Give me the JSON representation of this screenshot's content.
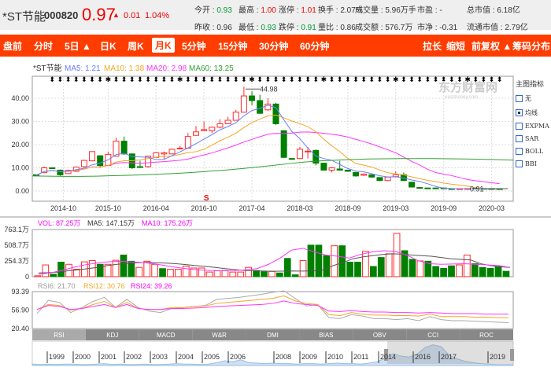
{
  "header": {
    "name": "*ST节能",
    "code": "000820",
    "price": "0.97",
    "change": "0.01",
    "change_pct": "1.04%",
    "quotes_row1": [
      [
        "今开",
        "0.93",
        "g"
      ],
      [
        "最高",
        "1.00",
        "r"
      ],
      [
        "涨停",
        "1.01",
        "r"
      ],
      [
        "换手",
        "2.07%",
        ""
      ],
      [
        "成交量",
        "5.96万手",
        ""
      ],
      [
        "市盈",
        "-",
        ""
      ],
      [
        "总市值",
        "6.18亿",
        ""
      ]
    ],
    "quotes_row2": [
      [
        "昨收",
        "0.96",
        ""
      ],
      [
        "最低",
        "0.93",
        "g"
      ],
      [
        "跌停",
        "0.91",
        "g"
      ],
      [
        "量比",
        "0.86",
        ""
      ],
      [
        "成交额",
        "576.7万",
        ""
      ],
      [
        "市净",
        "-0.31",
        ""
      ],
      [
        "流通市值",
        "2.79亿",
        ""
      ]
    ]
  },
  "nav": {
    "left": [
      "盘前",
      "分时",
      "5日 ▲",
      "日K",
      "周K",
      "月K",
      "5分钟",
      "15分钟",
      "30分钟",
      "60分钟"
    ],
    "active": "月K",
    "right": [
      "拉长",
      "缩短",
      "前复权 ▲",
      "筹码分布"
    ]
  },
  "main": {
    "title": "*ST节能",
    "ma5": "MA5: 1.21",
    "ma10": "MA10: 1.38",
    "ma20": "MA20: 2.98",
    "ma60": "MA60: 13.25",
    "yticks": [
      "40.00",
      "30.00",
      "20.00",
      "10.00",
      "0.00"
    ],
    "xticks": [
      "2014-10",
      "2015-10",
      "2016-04",
      "2016-10",
      "2017-04",
      "2018-03",
      "2018-09",
      "2019-03",
      "2019-09",
      "2020-03"
    ],
    "max_label": "44.98",
    "min_label": "0.91",
    "watermark": "东方财富网",
    "watermark_sub": "eastmoney.com",
    "marker": "S"
  },
  "side": {
    "title": "主图指标",
    "options": [
      {
        "label": "无",
        "checked": false
      },
      {
        "label": "均线",
        "checked": true
      },
      {
        "label": "EXPMA",
        "checked": false
      },
      {
        "label": "SAR",
        "checked": false
      },
      {
        "label": "BOLL",
        "checked": false
      },
      {
        "label": "BBI",
        "checked": false
      }
    ]
  },
  "volume": {
    "vol": "VOL: 87.25万",
    "ma5": "MA5: 147.15万",
    "ma10": "MA10: 175.26万",
    "yticks": [
      "763.1万",
      "508.7万",
      "254.3万",
      "0"
    ]
  },
  "rsi": {
    "rsi6": "RSI6: 21.70",
    "rsi12": "RSI12: 30.76",
    "rsi24": "RSI24: 39.26",
    "yticks": [
      "93.39",
      "56.90",
      "20.40"
    ]
  },
  "tabs": [
    "RSI",
    "KDJ",
    "MACD",
    "W&R",
    "DMI",
    "BIAS",
    "OBV",
    "CCI",
    "ROC"
  ],
  "active_tab": "RSI",
  "navigator": {
    "years": [
      "1999",
      "2000",
      "2001",
      "2002",
      "2003",
      "2004",
      "2005",
      "2006",
      "2008",
      "2009",
      "2010",
      "2011",
      "2014",
      "2016",
      "2017",
      "2019"
    ]
  },
  "colors": {
    "up": "#ff2a2a",
    "down": "#008000",
    "ma5": "#6b7fff",
    "ma10": "#f5a623",
    "ma20": "#ff33ff",
    "ma60": "#33a033",
    "accent": "#ff3d00"
  },
  "chart_data": {
    "type": "candlestick",
    "ylim": [
      -3,
      48
    ],
    "candles": [
      [
        7,
        6.8,
        7.2,
        6.6
      ],
      [
        7.9,
        10,
        10.5,
        7.8
      ],
      [
        10,
        9.8,
        10.2,
        9.5
      ],
      [
        9,
        7,
        9.3,
        6.5
      ],
      [
        7.5,
        8.9,
        9.2,
        7.3
      ],
      [
        8.5,
        10.3,
        10.6,
        8.4
      ],
      [
        10.5,
        13.2,
        13.5,
        10.2
      ],
      [
        13,
        17,
        17.2,
        12.8
      ],
      [
        15.2,
        11,
        15.4,
        10
      ],
      [
        11,
        15.8,
        17,
        10.8
      ],
      [
        15,
        21.5,
        23,
        14.8
      ],
      [
        21.5,
        16,
        23.5,
        15.5
      ],
      [
        16,
        10,
        16.2,
        9.5
      ],
      [
        10.5,
        10.2,
        13,
        10
      ],
      [
        10.5,
        15,
        15.2,
        10
      ],
      [
        14.5,
        16.5,
        16.8,
        14.3
      ],
      [
        16,
        16.5,
        17,
        13.5
      ],
      [
        16,
        18,
        18.3,
        15.8
      ],
      [
        18.2,
        18.5,
        19.5,
        18
      ],
      [
        18.5,
        23.5,
        25,
        18.3
      ],
      [
        24,
        25.5,
        28,
        23.8
      ],
      [
        26,
        26.5,
        30,
        25.8
      ],
      [
        26,
        27.5,
        27.8,
        25
      ],
      [
        27.5,
        29,
        31,
        27
      ],
      [
        29,
        30.5,
        32,
        28.8
      ],
      [
        30.5,
        34,
        35,
        30.3
      ],
      [
        34,
        41,
        44.98,
        33.8
      ],
      [
        41,
        39,
        43,
        37
      ],
      [
        39,
        33.5,
        41.5,
        33.3
      ],
      [
        35,
        37.5,
        40,
        34.5
      ],
      [
        37.5,
        29,
        38,
        28.5
      ],
      [
        26,
        14.5,
        26.2,
        14.3
      ],
      [
        14,
        13.8,
        14.3,
        13.5
      ],
      [
        14,
        18,
        19,
        13.8
      ],
      [
        17,
        17.2,
        19,
        14
      ],
      [
        17.5,
        12,
        18,
        11
      ],
      [
        12,
        9,
        12.2,
        8.8
      ],
      [
        9,
        10,
        10.3,
        8
      ],
      [
        9.5,
        9,
        13,
        8.8
      ],
      [
        9,
        8.5,
        9.2,
        8.3
      ],
      [
        8,
        6.5,
        8.2,
        6.2
      ],
      [
        6.8,
        7.3,
        7.6,
        6.5
      ],
      [
        7,
        6,
        7.2,
        5.8
      ],
      [
        5.8,
        4.5,
        6,
        4.3
      ],
      [
        4.5,
        6,
        6.2,
        4.3
      ],
      [
        6.2,
        7,
        8.5,
        6
      ],
      [
        7,
        4.5,
        8,
        4.3
      ],
      [
        3.8,
        1.7,
        3.9,
        1.6
      ],
      [
        1.5,
        1.4,
        1.7,
        1.3
      ],
      [
        1.3,
        1,
        1.4,
        0.95
      ],
      [
        1.3,
        1.1,
        1.4,
        1
      ],
      [
        1.3,
        1,
        1.35,
        0.95
      ],
      [
        1,
        0.9,
        1.1,
        0.85
      ],
      [
        0.95,
        1,
        1.1,
        0.9
      ],
      [
        0.95,
        1.05,
        1.1,
        0.9
      ],
      [
        1.2,
        1,
        1.25,
        0.95
      ],
      [
        1.1,
        1,
        1.15,
        0.95
      ],
      [
        1.05,
        1,
        1.1,
        0.91
      ],
      [
        1,
        0.97,
        1,
        0.93
      ]
    ],
    "ma60": [
      6.5,
      6.4,
      6.3,
      6.3,
      6.4,
      6.6,
      6.8,
      7,
      7.3,
      7.6,
      8,
      8.5,
      9,
      9.6,
      10.3,
      11,
      11.8,
      12.5,
      13,
      13.3,
      13.6,
      13.8,
      13.9,
      14,
      14,
      14,
      13.9,
      13.8,
      13.7,
      13.5,
      13.3
    ],
    "volume": [
      15,
      190,
      40,
      235,
      200,
      120,
      240,
      260,
      200,
      200,
      265,
      350,
      250,
      150,
      250,
      200,
      130,
      120,
      120,
      170,
      140,
      140,
      75,
      95,
      100,
      75,
      75,
      150,
      100,
      80,
      85,
      60,
      295,
      30,
      260,
      510,
      510,
      340,
      500,
      500,
      235,
      235,
      410,
      165,
      310,
      370,
      700,
      420,
      280,
      255,
      250,
      165,
      135,
      175,
      190,
      350,
      210,
      150,
      135,
      165,
      87
    ],
    "volume_up": [
      1,
      1,
      0,
      0,
      1,
      1,
      1,
      1,
      0,
      1,
      1,
      0,
      0,
      1,
      1,
      1,
      0,
      1,
      1,
      1,
      1,
      1,
      1,
      1,
      1,
      1,
      1,
      1,
      0,
      0,
      1,
      0,
      0,
      0,
      1,
      0,
      0,
      0,
      1,
      0,
      0,
      0,
      1,
      0,
      0,
      1,
      1,
      0,
      0,
      1,
      0,
      0,
      0,
      0,
      1,
      1,
      0,
      0,
      0,
      0,
      0
    ],
    "vol_ma5": [
      60,
      65,
      75,
      95,
      110,
      130,
      150,
      180,
      200,
      215,
      225,
      230,
      225,
      220,
      210,
      195,
      180,
      165,
      150,
      130,
      115,
      100,
      95,
      90,
      88,
      90,
      92,
      90,
      95,
      110,
      180,
      230,
      290,
      320,
      340,
      360,
      370,
      365,
      350,
      340,
      330,
      310,
      290,
      280,
      270,
      210,
      180,
      160,
      150
    ],
    "vol_ma10": [
      40,
      60,
      100,
      150,
      190,
      220,
      240,
      250,
      240,
      230,
      210,
      180,
      150,
      125,
      110,
      100,
      95,
      100,
      110,
      130,
      200,
      300,
      430,
      460,
      400,
      350,
      330,
      300,
      360,
      400,
      420,
      410,
      350,
      260,
      210,
      200,
      205,
      210,
      200,
      190,
      180,
      150
    ],
    "rsi6": [
      50,
      76,
      72,
      52,
      62,
      74,
      82,
      62,
      78,
      62,
      55,
      52,
      60,
      62,
      64,
      66,
      78,
      80,
      82,
      85,
      88,
      92,
      95,
      80,
      65,
      68,
      42,
      40,
      48,
      45,
      40,
      40,
      38,
      40,
      36,
      44,
      38,
      36,
      36,
      35,
      34,
      33,
      32
    ],
    "rsi12": [
      58,
      68,
      66,
      57,
      60,
      68,
      74,
      62,
      72,
      60,
      58,
      58,
      62,
      62,
      64,
      65,
      70,
      72,
      74,
      76,
      78,
      80,
      85,
      75,
      70,
      68,
      48,
      46,
      52,
      49,
      47,
      47,
      46,
      46,
      45,
      49,
      44,
      44,
      44,
      43,
      43,
      42,
      42
    ],
    "rsi24": [
      58,
      66,
      64,
      58,
      60,
      64,
      68,
      62,
      68,
      60,
      58,
      58,
      60,
      60,
      61,
      62,
      64,
      65,
      66,
      67,
      68,
      70,
      75,
      70,
      68,
      66,
      55,
      54,
      56,
      54,
      53,
      53,
      52,
      52,
      51,
      52,
      51,
      50,
      50,
      50,
      49,
      49,
      49
    ],
    "nav_area": [
      3,
      2,
      3,
      2,
      3,
      3,
      2,
      2,
      3,
      4,
      2,
      3,
      2,
      2,
      3,
      2,
      2,
      3,
      4,
      3,
      3,
      2,
      3,
      6,
      10,
      8,
      12,
      6,
      5,
      4,
      5,
      4,
      4,
      3,
      4,
      4,
      3,
      4,
      5,
      4,
      4,
      3,
      5,
      8,
      15,
      25,
      20,
      18,
      24,
      38,
      44,
      40,
      22,
      14,
      9,
      6,
      4,
      3,
      2,
      2,
      2
    ]
  }
}
